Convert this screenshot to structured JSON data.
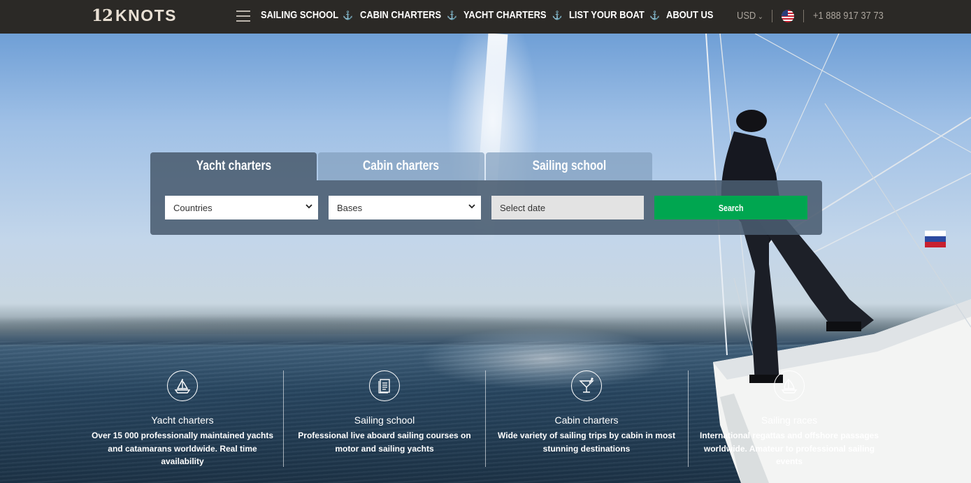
{
  "header": {
    "logo": {
      "num": "12",
      "word": "KNOTS"
    },
    "nav": [
      {
        "label": "SAILING SCHOOL"
      },
      {
        "label": "CABIN CHARTERS"
      },
      {
        "label": "YACHT CHARTERS"
      },
      {
        "label": "LIST YOUR BOAT"
      },
      {
        "label": "ABOUT US"
      }
    ],
    "nav_separator": "⚓",
    "currency": "USD",
    "phone": "+1 888 917 37 73"
  },
  "search": {
    "tabs": [
      {
        "label": "Yacht charters",
        "active": true
      },
      {
        "label": "Cabin charters",
        "active": false
      },
      {
        "label": "Sailing school",
        "active": false
      }
    ],
    "countries": "Countries",
    "bases": "Bases",
    "date_placeholder": "Select date",
    "button": "Search"
  },
  "features": [
    {
      "icon": "sailboat-icon",
      "title": "Yacht charters",
      "desc": "Over 15 000 professionally maintained yachts and catamarans worldwide. Real time availability"
    },
    {
      "icon": "book-icon",
      "title": "Sailing school",
      "desc": "Professional live aboard sailing courses on motor and sailing yachts"
    },
    {
      "icon": "cocktail-icon",
      "title": "Cabin charters",
      "desc": "Wide variety of sailing trips by cabin in most stunning destinations"
    },
    {
      "icon": "race-boat-icon",
      "title": "Sailing races",
      "desc": "International regattas and offshore passages worldwide. Amateur to professional sailing events"
    }
  ],
  "colors": {
    "topbar": "#2b2926",
    "search_button": "#00a650",
    "active_tab": "#4a5c70"
  }
}
